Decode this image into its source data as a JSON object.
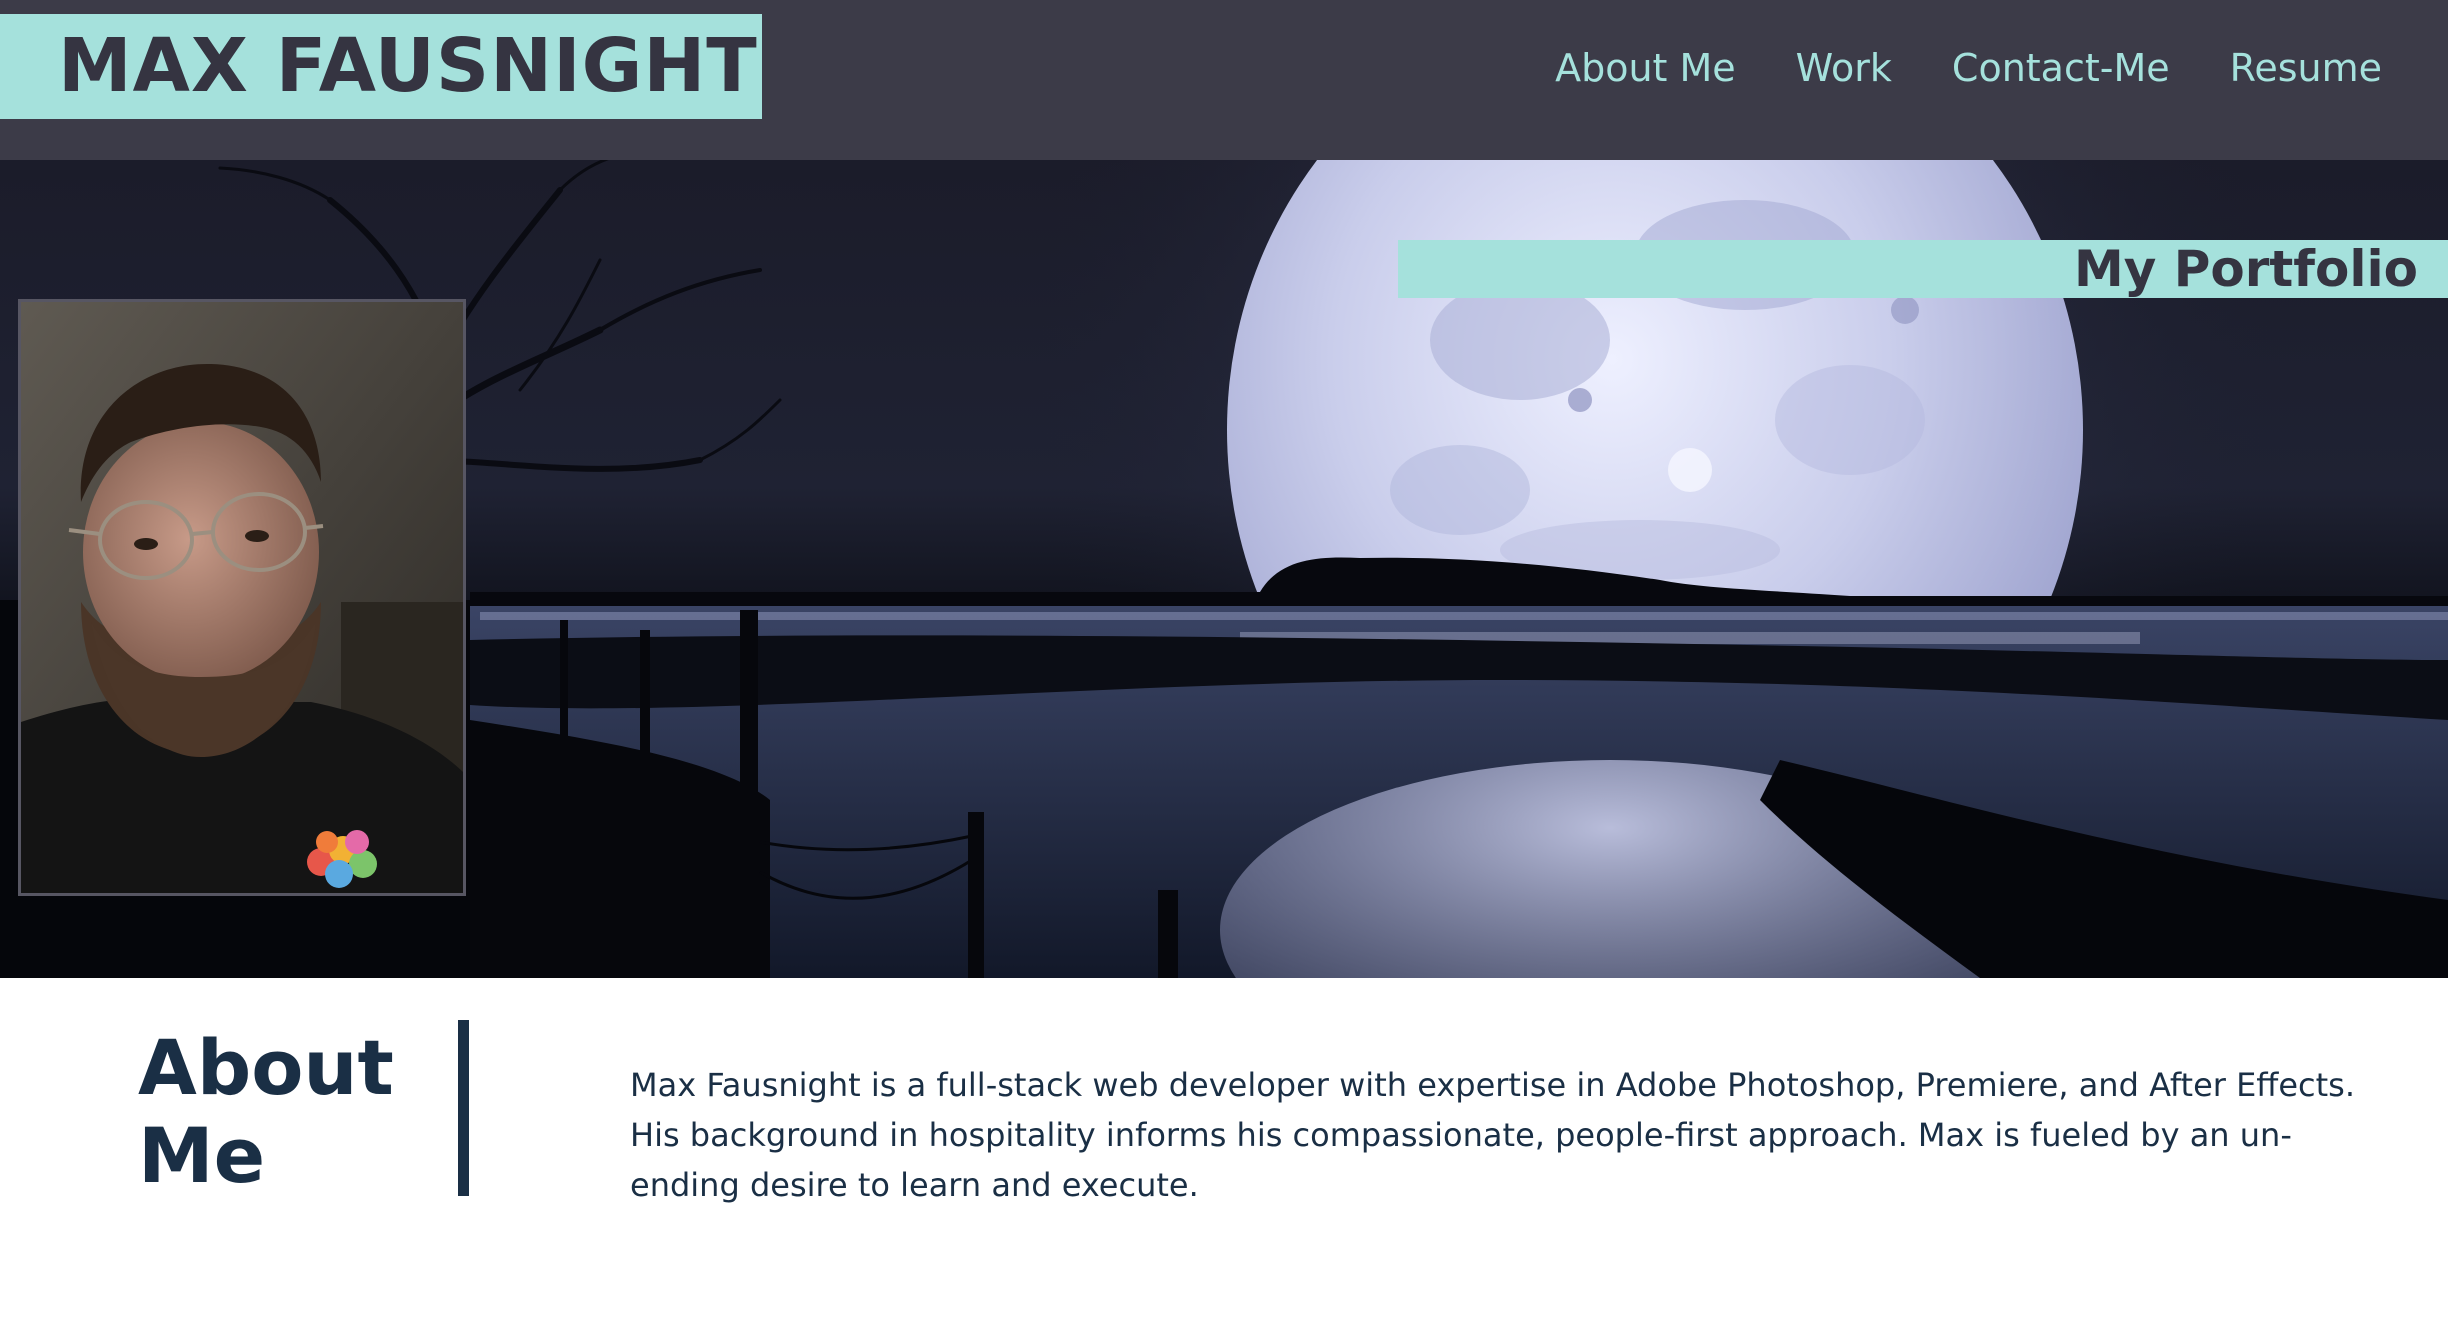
{
  "header": {
    "brand": "MAX FAUSNIGHT",
    "nav": [
      {
        "label": "About Me"
      },
      {
        "label": "Work"
      },
      {
        "label": "Contact-Me"
      },
      {
        "label": "Resume"
      }
    ]
  },
  "hero": {
    "banner_title": "My Portfolio",
    "background": "full moon rising over a marsh at night",
    "photo": "portrait of Max Fausnight"
  },
  "about": {
    "heading": "About Me",
    "body": "Max Fausnight is a full-stack web developer with expertise in Adobe Photoshop, Premiere, and After Effects. His background in hospitality informs his compassionate, people-first approach. Max is fueled by an un-ending desire to learn and execute."
  },
  "colors": {
    "accent": "#a5e1dc",
    "header_bg": "#3c3b48",
    "text_dark": "#1a2f45"
  }
}
